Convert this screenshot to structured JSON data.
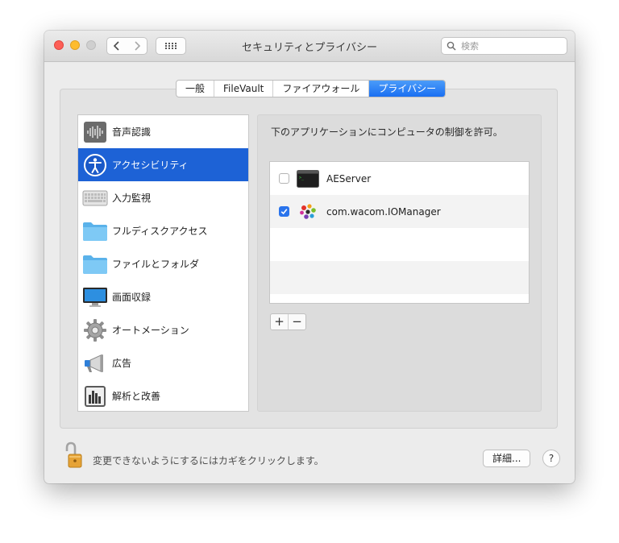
{
  "window": {
    "title": "セキュリティとプライバシー",
    "search": {
      "placeholder": "検索",
      "value": ""
    },
    "tabs": [
      {
        "label": "一般",
        "selected": false
      },
      {
        "label": "FileVault",
        "selected": false
      },
      {
        "label": "ファイアウォール",
        "selected": false
      },
      {
        "label": "プライバシー",
        "selected": true
      }
    ]
  },
  "sidebar": {
    "items": [
      {
        "label": "音声認識",
        "icon": "waveform-icon"
      },
      {
        "label": "アクセシビリティ",
        "icon": "accessibility-icon",
        "selected": true
      },
      {
        "label": "入力監視",
        "icon": "keyboard-icon"
      },
      {
        "label": "フルディスクアクセス",
        "icon": "folder-icon"
      },
      {
        "label": "ファイルとフォルダ",
        "icon": "folder-icon"
      },
      {
        "label": "画面収録",
        "icon": "display-icon"
      },
      {
        "label": "オートメーション",
        "icon": "gear-icon"
      },
      {
        "label": "広告",
        "icon": "megaphone-icon"
      },
      {
        "label": "解析と改善",
        "icon": "bar-chart-icon"
      }
    ]
  },
  "main": {
    "heading": "下のアプリケーションにコンピュータの制御を許可。",
    "apps": [
      {
        "name": "AEServer",
        "checked": false,
        "icon": "terminal-icon"
      },
      {
        "name": "com.wacom.IOManager",
        "checked": true,
        "icon": "wacom-icon"
      }
    ],
    "add_label": "+",
    "remove_label": "−"
  },
  "footer": {
    "lock_text": "変更できないようにするにはカギをクリックします。",
    "advanced_label": "詳細...",
    "help_label": "?"
  },
  "colors": {
    "accent": "#1d62d6",
    "tab_selected": "#2a7bf4",
    "window_bg": "#ececec",
    "close": "#fd5f57",
    "minimize": "#febc2e"
  }
}
